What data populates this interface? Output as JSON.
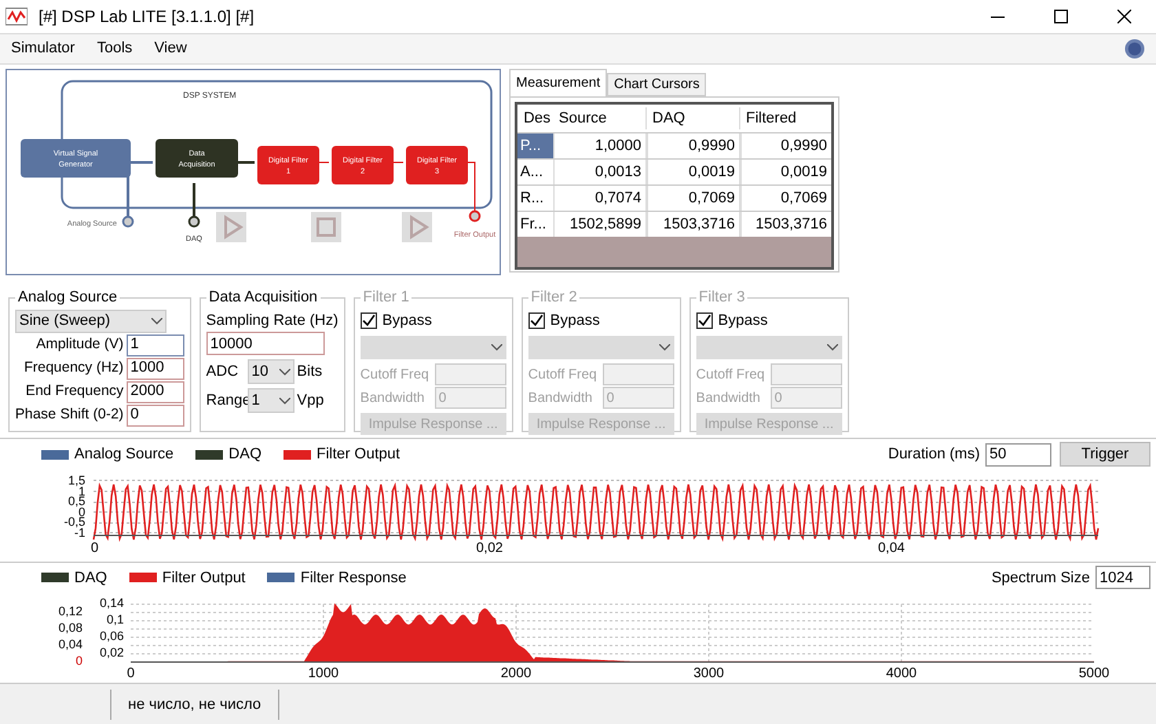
{
  "window": {
    "title": "[#] DSP Lab LITE [3.1.1.0] [#]"
  },
  "menu": [
    "Simulator",
    "Tools",
    "View"
  ],
  "diagram": {
    "system_label": "DSP SYSTEM",
    "blocks": [
      {
        "kind": "source",
        "label": "Virtual Signal Generator"
      },
      {
        "kind": "daq",
        "label": "Data Acquisition"
      },
      {
        "kind": "filter",
        "label": "Digital Filter 1"
      },
      {
        "kind": "filter",
        "label": "Digital Filter 2"
      },
      {
        "kind": "filter",
        "label": "Digital Filter 3"
      }
    ],
    "probes": [
      "Analog Source",
      "DAQ",
      "Filter Output"
    ]
  },
  "tabs": [
    {
      "label": "Measurement",
      "selected": true
    },
    {
      "label": "Chart Cursors",
      "selected": false
    }
  ],
  "table": {
    "columns": [
      "Des",
      "Source",
      "DAQ",
      "Filtered"
    ],
    "rows": [
      {
        "cells": [
          "P...",
          "1,0000",
          "0,9990",
          "0,9990"
        ],
        "selected": true
      },
      {
        "cells": [
          "A...",
          "0,0013",
          "0,0019",
          "0,0019"
        ],
        "selected": false
      },
      {
        "cells": [
          "R...",
          "0,7074",
          "0,7069",
          "0,7069"
        ],
        "selected": false
      },
      {
        "cells": [
          "Fr...",
          "1502,5899",
          "1503,3716",
          "1503,3716"
        ],
        "selected": false
      }
    ]
  },
  "analog_source": {
    "title": "Analog Source",
    "waveform": "Sine (Sweep)",
    "fields": [
      {
        "label": "Amplitude (V)",
        "value": "1"
      },
      {
        "label": "Frequency (Hz)",
        "value": "1000"
      },
      {
        "label": "End Frequency",
        "value": "2000"
      },
      {
        "label": "Phase Shift (0-2)",
        "value": "0"
      }
    ]
  },
  "acquisition": {
    "title": "Data Acquisition",
    "rate_label": "Sampling Rate (Hz)",
    "rate": "10000",
    "adc_label": "ADC",
    "adc": "10",
    "adc_unit": "Bits",
    "range_label": "Range",
    "range": "1",
    "range_unit": "Vpp"
  },
  "filters": [
    {
      "title": "Filter 1",
      "bypass_label": "Bypass",
      "bypass": true,
      "disabled": true,
      "cutoff_label": "Cutoff Freq",
      "bandwidth_label": "Bandwidth",
      "bandwidth": "0",
      "button": "Impulse Response ..."
    },
    {
      "title": "Filter 2",
      "bypass_label": "Bypass",
      "bypass": true,
      "disabled": true,
      "cutoff_label": "Cutoff Freq",
      "bandwidth_label": "Bandwidth",
      "bandwidth": "0",
      "button": "Impulse Response ..."
    },
    {
      "title": "Filter 3",
      "bypass_label": "Bypass",
      "bypass": true,
      "disabled": true,
      "cutoff_label": "Cutoff Freq",
      "bandwidth_label": "Bandwidth",
      "bandwidth": "0",
      "button": "Impulse Response ..."
    }
  ],
  "time_chart": {
    "legend": [
      {
        "label": "Analog Source",
        "color": "#4a6a9a"
      },
      {
        "label": "DAQ",
        "color": "#2f3a2a"
      },
      {
        "label": "Filter Output",
        "color": "#e02020"
      }
    ],
    "duration_label": "Duration (ms)",
    "duration": "50",
    "trigger": "Trigger",
    "ytick_labels": [
      "1,5",
      "1",
      "0,5",
      "0",
      "-0,5",
      "-1"
    ],
    "xtick_labels": [
      "0",
      "0,02",
      "0,04"
    ]
  },
  "spectrum_chart": {
    "legend": [
      {
        "label": "DAQ",
        "color": "#2f3a2a"
      },
      {
        "label": "Filter Output",
        "color": "#e02020"
      },
      {
        "label": "Filter Response",
        "color": "#4a6a9a"
      }
    ],
    "size_label": "Spectrum Size",
    "size": "1024",
    "ytick_labels": [
      "0,14",
      "0,12",
      "0,1",
      "0,08",
      "0,06",
      "0,04",
      "0,02",
      "0"
    ],
    "xtick_labels": [
      "0",
      "1000",
      "2000",
      "3000",
      "4000",
      "5000"
    ]
  },
  "status_bar": {
    "text": "не число, не число"
  }
}
